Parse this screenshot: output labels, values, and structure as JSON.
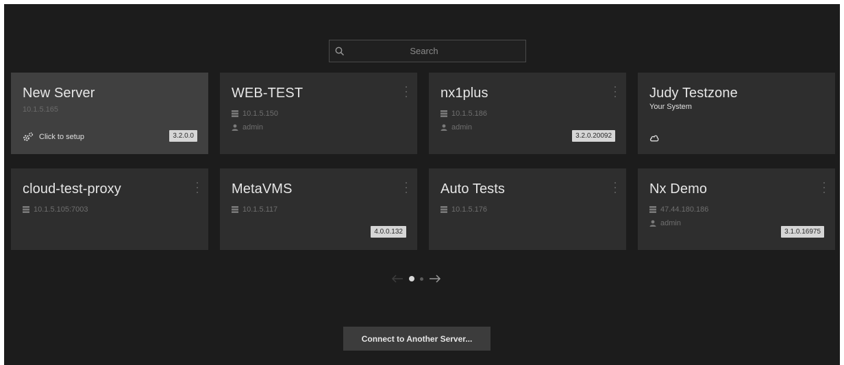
{
  "search": {
    "placeholder": "Search"
  },
  "tiles": [
    {
      "name": "New Server",
      "ip": "10.1.5.165",
      "setup_label": "Click to setup",
      "version": "3.2.0.0"
    },
    {
      "name": "WEB-TEST",
      "ip": "10.1.5.150",
      "user": "admin"
    },
    {
      "name": "nx1plus",
      "ip": "10.1.5.186",
      "user": "admin",
      "version": "3.2.0.20092"
    },
    {
      "name": "Judy Testzone",
      "subtitle": "Your System"
    },
    {
      "name": "cloud-test-proxy",
      "ip": "10.1.5.105:7003"
    },
    {
      "name": "MetaVMS",
      "ip": "10.1.5.117",
      "version": "4.0.0.132"
    },
    {
      "name": "Auto Tests",
      "ip": "10.1.5.176"
    },
    {
      "name": "Nx Demo",
      "ip": "47.44.180.186",
      "user": "admin",
      "version": "3.1.0.16975"
    }
  ],
  "pagination": {
    "current": 1,
    "total": 2
  },
  "connect_button": "Connect to Another Server...",
  "colors": {
    "background": "#1c1c1c",
    "tile": "#2e2e2e",
    "tile_highlight": "#404040",
    "badge": "#d6d6d6"
  }
}
